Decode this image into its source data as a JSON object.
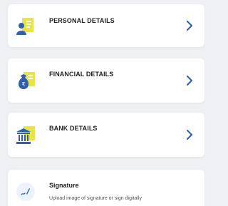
{
  "cards": [
    {
      "title": "PERSONAL DETAILS",
      "icon": "personal-id-icon"
    },
    {
      "title": "FINANCIAL DETAILS",
      "icon": "money-bag-rupee-icon"
    },
    {
      "title": "BANK DETAILS",
      "icon": "bank-building-icon"
    }
  ],
  "signature": {
    "title": "Signature",
    "description": "Upload image of signature or sign digitally",
    "icon": "pen-signature-icon"
  },
  "colors": {
    "background": "#eef0f3",
    "card": "#ffffff",
    "accent_blue": "#2f5fad",
    "accent_yellow": "#e6e44a",
    "chevron": "#2f5fad"
  }
}
